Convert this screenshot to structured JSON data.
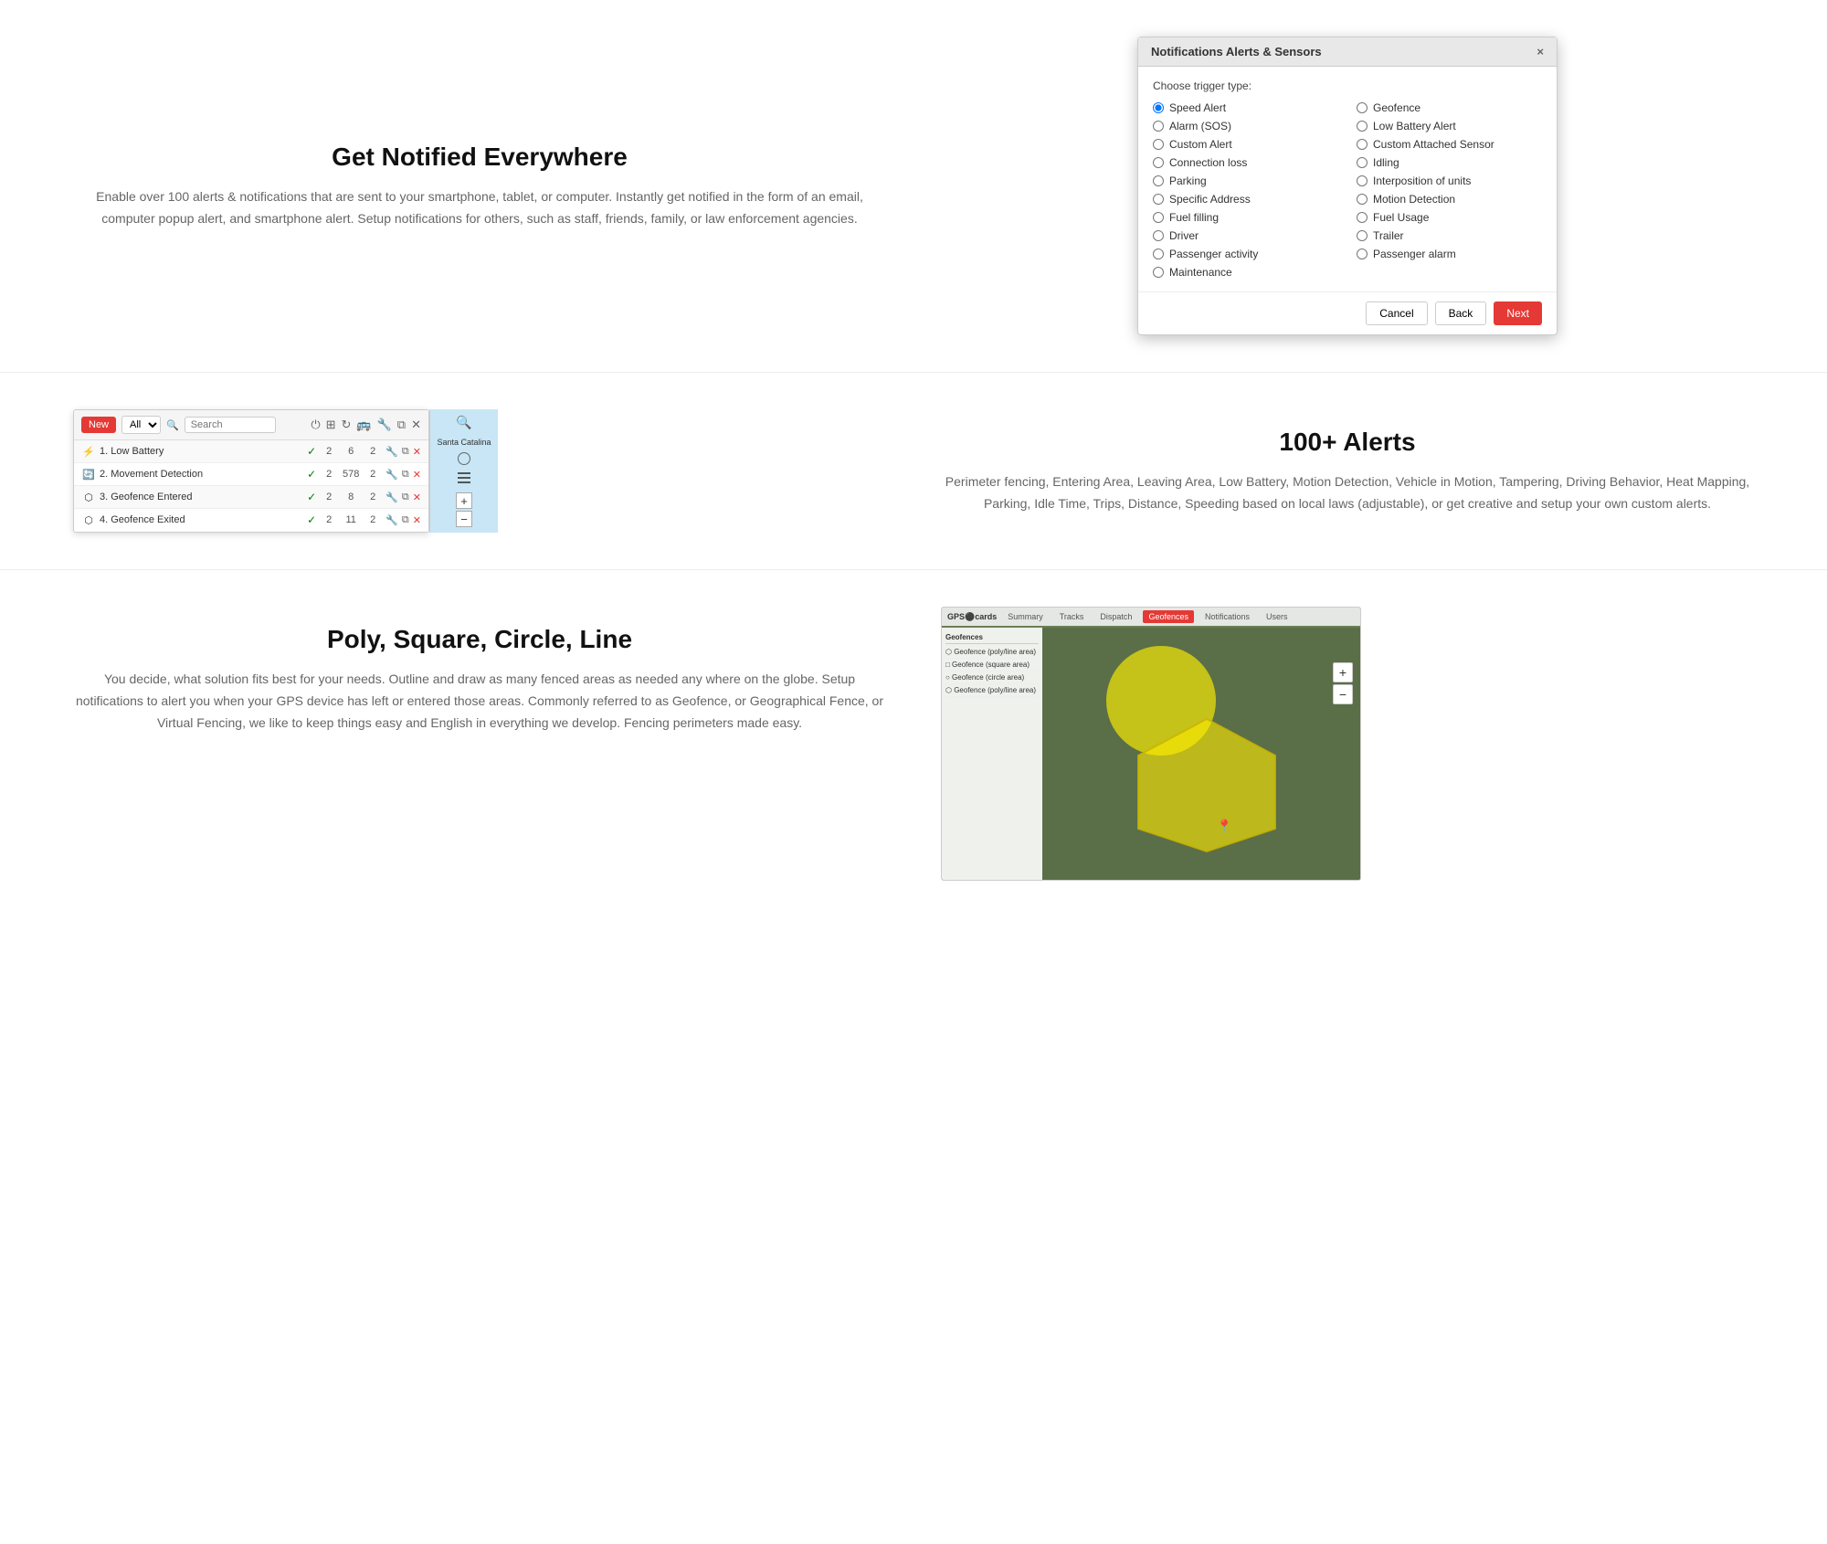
{
  "section1": {
    "title": "Get Notified Everywhere",
    "description": "Enable over 100 alerts & notifications that are sent to your smartphone, tablet, or computer. Instantly get notified in the form of an email, computer popup alert, and smartphone alert. Setup notifications for others, such as staff, friends, family, or law enforcement agencies.",
    "modal": {
      "title": "Notifications Alerts & Sensors",
      "trigger_label": "Choose trigger type:",
      "close": "×",
      "options_left": [
        {
          "label": "Speed Alert",
          "checked": true
        },
        {
          "label": "Alarm (SOS)",
          "checked": false
        },
        {
          "label": "Custom Alert",
          "checked": false
        },
        {
          "label": "Connection loss",
          "checked": false
        },
        {
          "label": "Parking",
          "checked": false
        },
        {
          "label": "Specific Address",
          "checked": false
        },
        {
          "label": "Fuel filling",
          "checked": false
        },
        {
          "label": "Driver",
          "checked": false
        },
        {
          "label": "Passenger activity",
          "checked": false
        },
        {
          "label": "Maintenance",
          "checked": false
        }
      ],
      "options_right": [
        {
          "label": "Geofence",
          "checked": false
        },
        {
          "label": "Low Battery Alert",
          "checked": false
        },
        {
          "label": "Custom Attached Sensor",
          "checked": false
        },
        {
          "label": "Idling",
          "checked": false
        },
        {
          "label": "Interposition of units",
          "checked": false
        },
        {
          "label": "Motion Detection",
          "checked": false
        },
        {
          "label": "Fuel Usage",
          "checked": false
        },
        {
          "label": "Trailer",
          "checked": false
        },
        {
          "label": "Passenger alarm",
          "checked": false
        }
      ],
      "btn_cancel": "Cancel",
      "btn_back": "Back",
      "btn_next": "Next"
    }
  },
  "section2": {
    "title": "100+ Alerts",
    "description": "Perimeter fencing, Entering Area, Leaving Area, Low Battery, Motion Detection, Vehicle in Motion, Tampering, Driving Behavior, Heat Mapping, Parking, Idle Time, Trips, Distance, Speeding based on local laws (adjustable), or get creative and setup your own custom alerts.",
    "alert_list": {
      "btn_new": "New",
      "select_placeholder": "All",
      "search_placeholder": "Search",
      "rows": [
        {
          "icon": "⚡",
          "num": "1.",
          "name": "Low Battery",
          "active": true,
          "val1": "2",
          "val2": "6",
          "val3": "2"
        },
        {
          "icon": "🔄",
          "num": "2.",
          "name": "Movement Detection",
          "active": true,
          "val1": "2",
          "val2": "578",
          "val3": "2"
        },
        {
          "icon": "⬡",
          "num": "3.",
          "name": "Geofence Entered",
          "active": true,
          "val1": "2",
          "val2": "8",
          "val3": "2"
        },
        {
          "icon": "⬡",
          "num": "4.",
          "name": "Geofence Exited",
          "active": true,
          "val1": "2",
          "val2": "11",
          "val3": "2"
        }
      ],
      "map_label": "Santa Catalina"
    }
  },
  "section3": {
    "title": "Poly, Square, Circle, Line",
    "description": "You decide, what solution fits best for your needs. Outline and draw as many fenced areas as needed any where on the globe. Setup notifications to alert you when your GPS device has left or entered those areas. Commonly referred to as Geofence, or Geographical Fence, or Virtual Fencing, we like to keep things easy and English in everything we develop. Fencing perimeters made easy.",
    "geo_tabs": [
      "Summary",
      "Tracks",
      "Dispatch",
      "Geofences",
      "Notifications",
      "Users"
    ],
    "geo_active_tab": "Geofences",
    "geo_sidebar_items": [
      "Geofence (poly/line area)",
      "Geofence (square area)",
      "Geofence (circle area)",
      "Geofence (poly/line area)"
    ],
    "zoom_in": "+",
    "zoom_out": "−"
  }
}
